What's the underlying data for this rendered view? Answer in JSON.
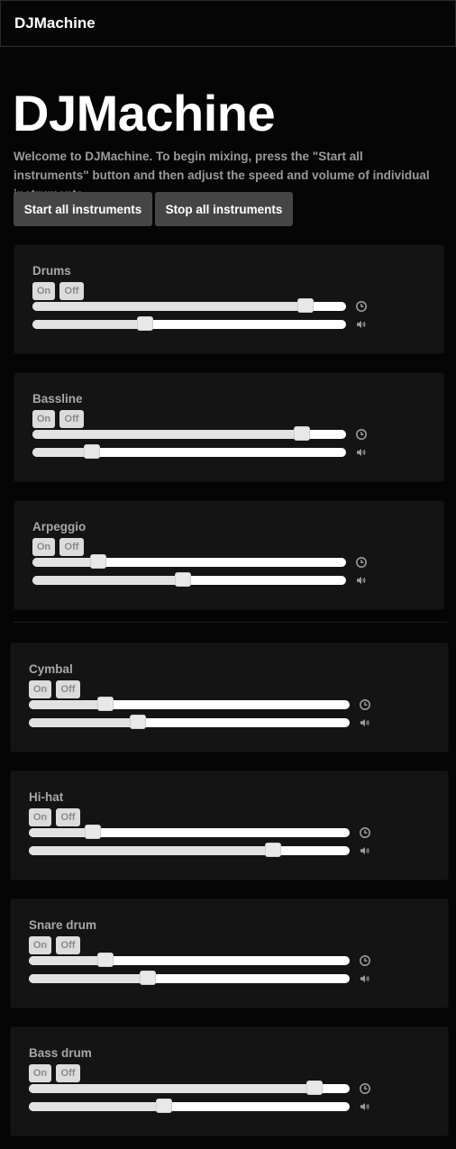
{
  "navbar": {
    "brand": "DJMachine"
  },
  "header": {
    "title": "DJMachine",
    "intro": "Welcome to DJMachine. To begin mixing, press the \"Start all instruments\" button and then adjust the speed and volume of individual instruments."
  },
  "controls": {
    "start_label": "Start all instruments",
    "stop_label": "Stop all instruments"
  },
  "labels": {
    "on": "On",
    "off": "Off"
  },
  "instruments": [
    {
      "name": "Drums",
      "speed_pct": 87,
      "volume_pct": 36
    },
    {
      "name": "Bassline",
      "speed_pct": 86,
      "volume_pct": 19
    },
    {
      "name": "Arpeggio",
      "speed_pct": 21,
      "volume_pct": 48
    },
    {
      "name": "Cymbal",
      "speed_pct": 24,
      "volume_pct": 34
    },
    {
      "name": "Hi-hat",
      "speed_pct": 20,
      "volume_pct": 76
    },
    {
      "name": "Snare drum",
      "speed_pct": 24,
      "volume_pct": 37
    },
    {
      "name": "Bass drum",
      "speed_pct": 89,
      "volume_pct": 42
    }
  ],
  "icons": {
    "speed": "clock-icon",
    "volume": "volume-icon"
  },
  "colors": {
    "background": "#050505",
    "card": "#141414",
    "button": "#454545"
  }
}
